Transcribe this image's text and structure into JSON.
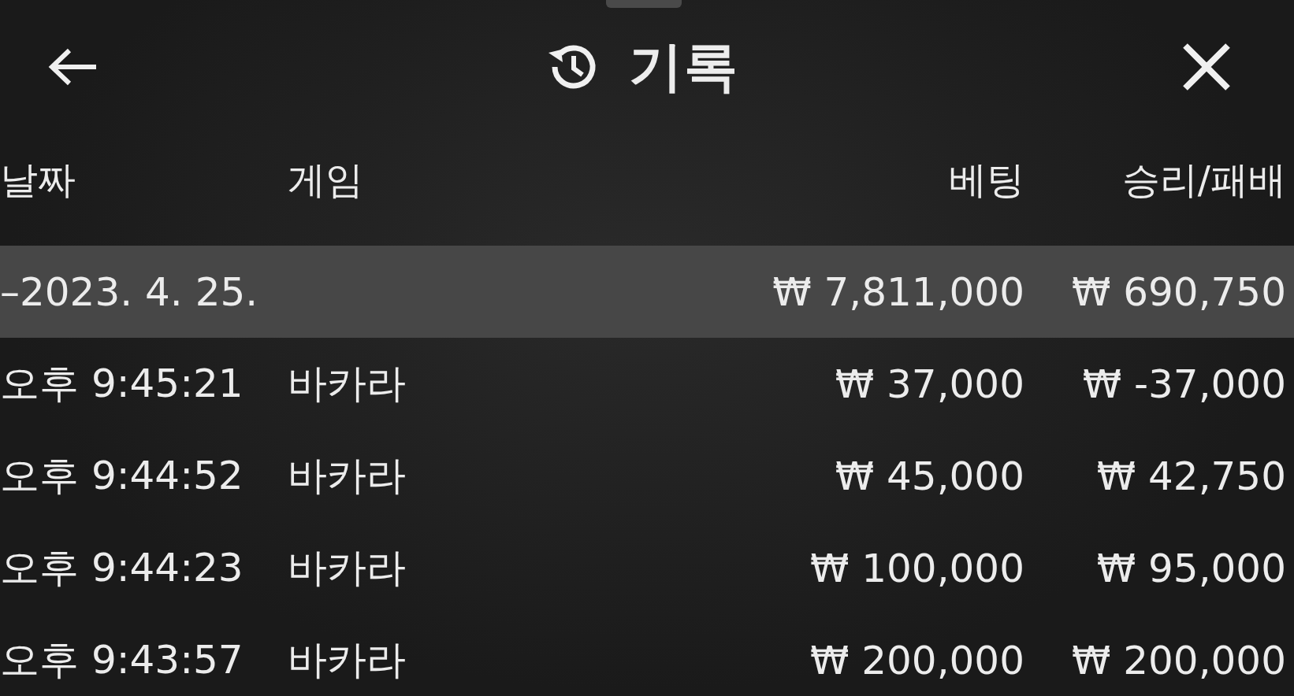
{
  "header": {
    "title": "기록"
  },
  "table": {
    "columns": [
      "날짜",
      "게임",
      "베팅",
      "승리/패배"
    ],
    "rows": [
      {
        "kind": "date",
        "date": "–2023. 4. 25.",
        "bet": "₩ 7,811,000",
        "result": "₩ 690,750"
      },
      {
        "kind": "entry",
        "date": "오후 9:45:21",
        "game": "바카라",
        "bet": "₩ 37,000",
        "result": "₩ -37,000"
      },
      {
        "kind": "entry",
        "date": "오후 9:44:52",
        "game": "바카라",
        "bet": "₩ 45,000",
        "result": "₩ 42,750"
      },
      {
        "kind": "entry",
        "date": "오후 9:44:23",
        "game": "바카라",
        "bet": "₩ 100,000",
        "result": "₩ 95,000"
      },
      {
        "kind": "entry",
        "date": "오후 9:43:57",
        "game": "바카라",
        "bet": "₩ 200,000",
        "result": "₩ 200,000"
      }
    ]
  }
}
